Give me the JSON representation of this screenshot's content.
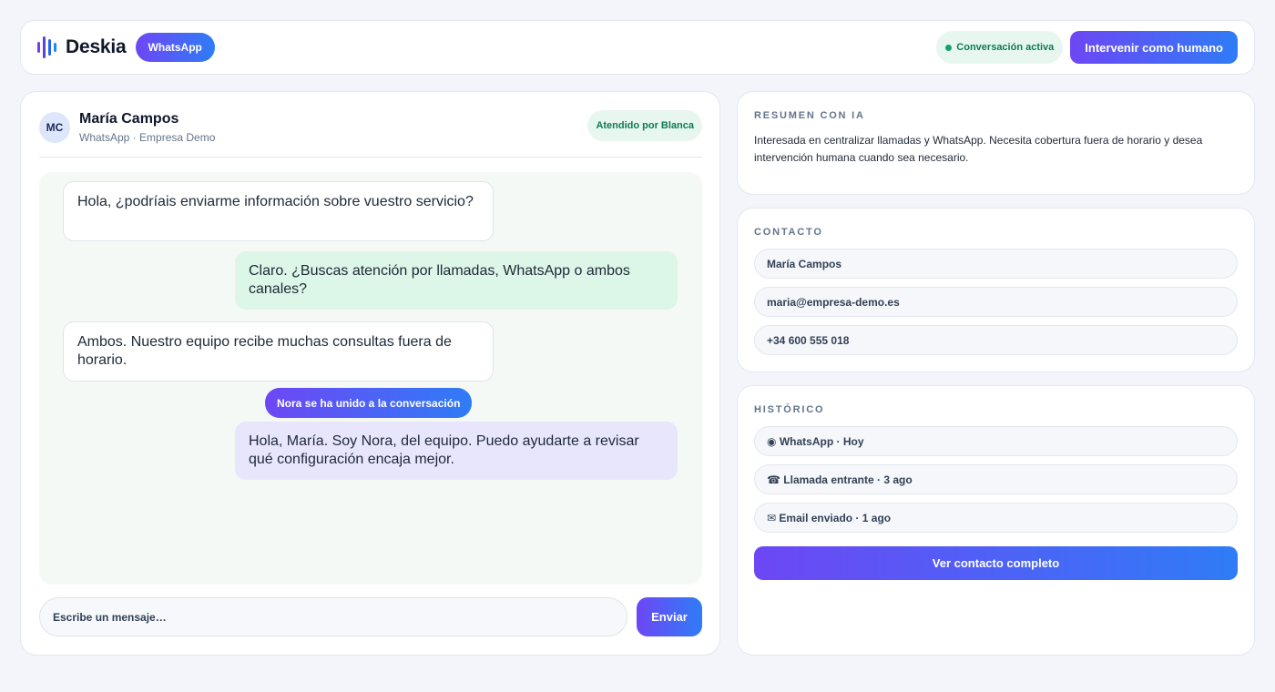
{
  "brand": {
    "name": "Deskia"
  },
  "header": {
    "channel": "WhatsApp",
    "status": "Conversación activa",
    "intervene_label": "Intervenir como humano"
  },
  "chat": {
    "contact": {
      "initials": "MC",
      "name": "María Campos",
      "subtitle": "WhatsApp · Empresa Demo"
    },
    "attended_by": "Atendido por Blanca",
    "messages": [
      {
        "direction": "incoming",
        "text": "Hola, ¿podríais enviarme información sobre vuestro servicio?"
      },
      {
        "direction": "outgoing",
        "text": "Claro. ¿Buscas atención por llamadas, WhatsApp o ambos canales?"
      },
      {
        "direction": "incoming",
        "text": "Ambos. Nuestro equipo recibe muchas consultas fuera de horario."
      },
      {
        "direction": "agent",
        "text": "Hola, María. Soy Nora, del equipo. Puedo ayudarte a revisar qué configuración encaja mejor."
      }
    ],
    "system_notice": "Nora se ha unido a la conversación",
    "composer": {
      "placeholder": "Escribe un mensaje…",
      "send_label": "Enviar"
    }
  },
  "summary": {
    "title": "Resumen con IA",
    "text": "Interesada en centralizar llamadas y WhatsApp. Necesita cobertura fuera de horario y desea intervención humana cuando sea necesario."
  },
  "contact_card": {
    "title": "Contacto",
    "name": "María Campos",
    "email": "maria@empresa-demo.es",
    "phone": "+34 600 555 018"
  },
  "history": {
    "title": "Histórico",
    "items": [
      {
        "icon": "whatsapp-icon",
        "glyph": "◉",
        "text": "WhatsApp · Hoy"
      },
      {
        "icon": "phone-icon",
        "glyph": "☎",
        "text": "Llamada entrante · 3 ago"
      },
      {
        "icon": "mail-icon",
        "glyph": "✉",
        "text": "Email enviado · 1 ago"
      }
    ],
    "button_label": "Ver contacto completo"
  },
  "colors": {
    "accent_start": "#6d47f5",
    "accent_end": "#2f7cf6",
    "active_green": "#0f7a52"
  }
}
